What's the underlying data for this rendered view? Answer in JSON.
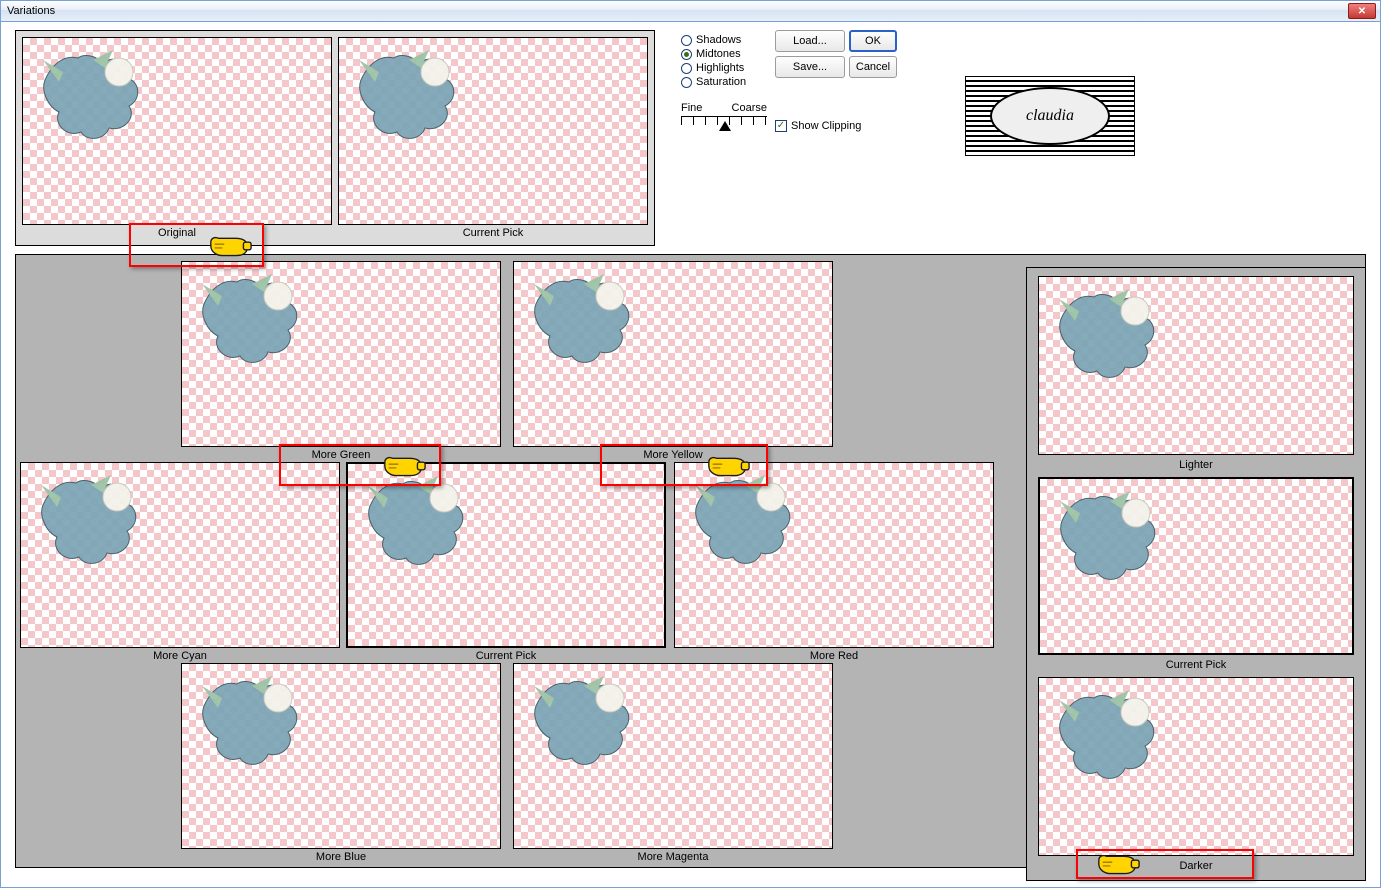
{
  "window": {
    "title": "Variations"
  },
  "topPreview": {
    "original_label": "Original",
    "current_label": "Current Pick"
  },
  "controls": {
    "radios": {
      "shadows": "Shadows",
      "midtones": "Midtones",
      "highlights": "Highlights",
      "saturation": "Saturation",
      "selected": "midtones"
    },
    "slider": {
      "left_label": "Fine",
      "right_label": "Coarse"
    },
    "show_clipping_label": "Show Clipping",
    "show_clipping_checked": true,
    "buttons": {
      "load": "Load...",
      "save": "Save...",
      "ok": "OK",
      "cancel": "Cancel"
    },
    "logo_text": "claudia"
  },
  "hex": {
    "green": "More Green",
    "yellow": "More Yellow",
    "cyan": "More Cyan",
    "center": "Current Pick",
    "red": "More Red",
    "blue": "More Blue",
    "magenta": "More Magenta"
  },
  "rightCol": {
    "lighter": "Lighter",
    "center": "Current Pick",
    "darker": "Darker"
  }
}
